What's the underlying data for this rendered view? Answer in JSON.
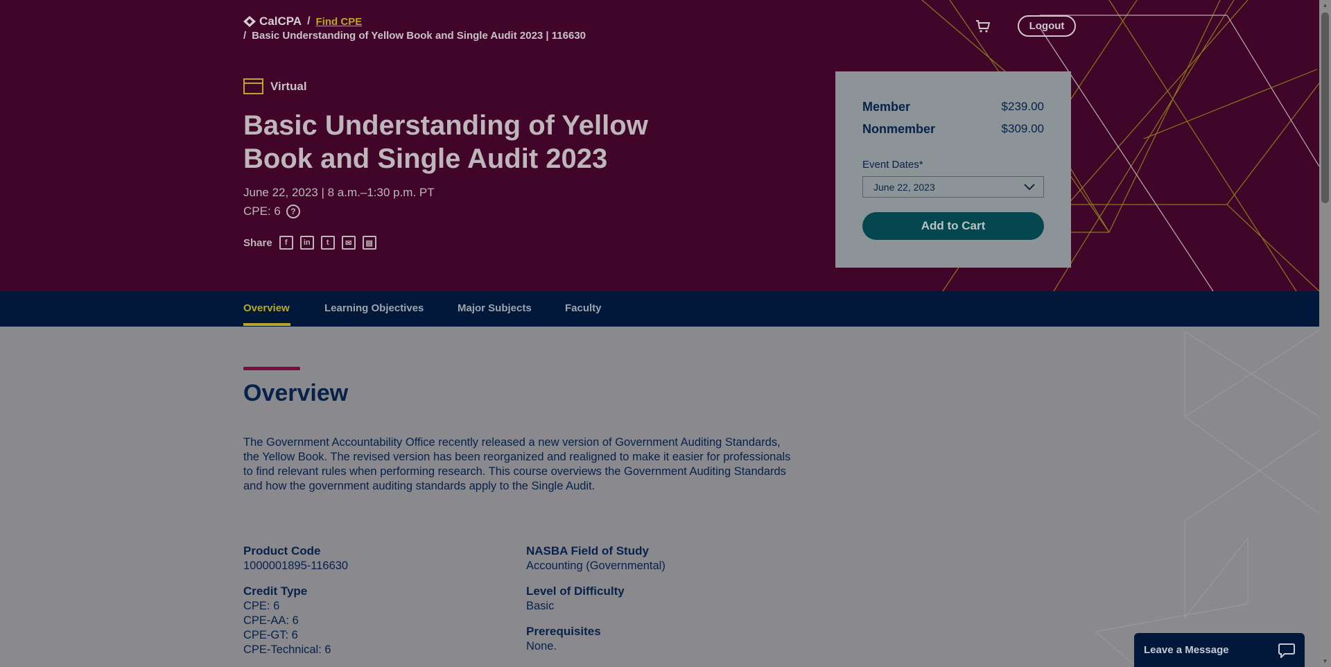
{
  "breadcrumb": {
    "brand": "CalCPA",
    "link": "Find CPE",
    "current": "Basic Understanding of Yellow Book and Single Audit 2023 | 116630"
  },
  "header": {
    "logout_label": "Logout",
    "cart_icon": "cart-icon"
  },
  "course": {
    "format": "Virtual",
    "title": "Basic Understanding of Yellow Book and Single Audit 2023",
    "date_line": "June 22, 2023 | 8 a.m.–1:30 p.m. PT",
    "cpe_line": "CPE: 6",
    "share_label": "Share",
    "share_icons": [
      "facebook-icon",
      "linkedin-icon",
      "twitter-icon",
      "email-icon",
      "print-icon"
    ]
  },
  "pricing": {
    "member_label": "Member",
    "member_price": "$239.00",
    "nonmember_label": "Nonmember",
    "nonmember_price": "$309.00",
    "event_dates_label": "Event Dates*",
    "event_date_selected": "June 22, 2023",
    "add_to_cart_label": "Add to Cart"
  },
  "tabs": [
    {
      "label": "Overview",
      "active": true
    },
    {
      "label": "Learning Objectives",
      "active": false
    },
    {
      "label": "Major Subjects",
      "active": false
    },
    {
      "label": "Faculty",
      "active": false
    }
  ],
  "overview": {
    "title": "Overview",
    "text": "The Government Accountability Office recently released a new version of Government Auditing Standards, the Yellow Book. The revised version has been reorganized and realigned to make it easier for professionals to find relevant rules when performing research. This course overviews the Government Auditing Standards and how the government auditing standards apply to the Single Audit.",
    "product_code_label": "Product Code",
    "product_code": "1000001895-116630",
    "credit_type_label": "Credit Type",
    "credit_types": [
      "CPE: 6",
      "CPE-AA: 6",
      "CPE-GT: 6",
      "CPE-Technical: 6"
    ],
    "field_label": "NASBA Field of Study",
    "field": "Accounting (Governmental)",
    "difficulty_label": "Level of Difficulty",
    "difficulty": "Basic",
    "prereq_label": "Prerequisites",
    "prereq": "None."
  },
  "chat": {
    "label": "Leave a Message"
  },
  "colors": {
    "hero_bg": "#42052a",
    "accent_gold": "#b8a822",
    "tabbar_bg": "#02183a",
    "button_teal": "#05474f"
  }
}
